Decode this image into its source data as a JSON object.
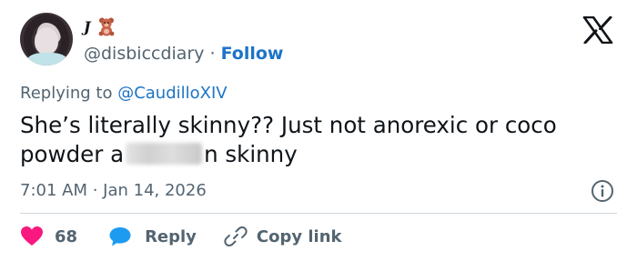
{
  "author": {
    "display_name": "𝑱",
    "handle": "@disbiccdiary",
    "separator": "·",
    "follow_label": "Follow"
  },
  "reply_context": {
    "prefix": "Replying to ",
    "mention": "@CaudilloXIV"
  },
  "tweet": {
    "line1": "She’s literally skinny?? Just not anorexic or coco",
    "line2_before": "powder a",
    "line2_after": "n skinny"
  },
  "meta": {
    "timestamp": "7:01 AM · Jan 14, 2026"
  },
  "actions": {
    "like_count": "68",
    "reply_label": "Reply",
    "copy_link_label": "Copy link"
  },
  "colors": {
    "like_red": "#f91880",
    "reply_blue": "#1d9bf0",
    "link_blue": "#1d74c7",
    "muted": "#536471"
  },
  "icons": [
    "teddy-bear-icon",
    "x-logo-icon",
    "info-icon",
    "heart-icon",
    "reply-bubble-icon",
    "link-icon"
  ]
}
